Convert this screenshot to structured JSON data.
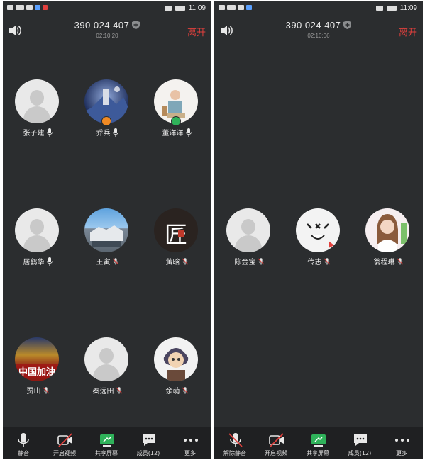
{
  "left": {
    "status": {
      "time": "11:09"
    },
    "header": {
      "meeting_id": "390 024 407",
      "timer": "02:10:20",
      "leave": "离开"
    },
    "participants": [
      {
        "name": "张子建",
        "mic": "on",
        "avatar": "default-avatar"
      },
      {
        "name": "乔兵",
        "mic": "on",
        "avatar": "space-photo",
        "badge": "host"
      },
      {
        "name": "董洋洋",
        "mic": "on",
        "avatar": "child-photo",
        "badge": "cohost"
      },
      {
        "name": "居鹤华",
        "mic": "on",
        "avatar": "default-avatar"
      },
      {
        "name": "王寅",
        "mic": "muted",
        "avatar": "building-photo"
      },
      {
        "name": "黄晗",
        "mic": "muted",
        "avatar": "calligraphy-avatar"
      },
      {
        "name": "贾山",
        "mic": "muted",
        "avatar": "slogan-photo"
      },
      {
        "name": "秦远田",
        "mic": "muted",
        "avatar": "default-avatar"
      },
      {
        "name": "余萌",
        "mic": "muted",
        "avatar": "cartoon-avatar"
      }
    ],
    "slogan_text": "中国加油",
    "calligraphy_char": "匠",
    "toolbar": [
      {
        "label": "静音",
        "icon": "microphone-icon"
      },
      {
        "label": "开启视频",
        "icon": "video-off-icon"
      },
      {
        "label": "共享屏幕",
        "icon": "share-screen-icon"
      },
      {
        "label": "成员(12)",
        "icon": "members-icon"
      },
      {
        "label": "更多",
        "icon": "more-icon"
      }
    ]
  },
  "right": {
    "status": {
      "time": "11:09"
    },
    "header": {
      "meeting_id": "390 024 407",
      "timer": "02:10:06",
      "leave": "离开"
    },
    "participants": [
      {
        "name": "陈金宝",
        "mic": "muted",
        "avatar": "default-avatar"
      },
      {
        "name": "传志",
        "mic": "muted",
        "avatar": "cute-face-avatar"
      },
      {
        "name": "翁程琳",
        "mic": "muted",
        "avatar": "girl-photo"
      }
    ],
    "toolbar": [
      {
        "label": "解除静音",
        "icon": "microphone-muted-icon"
      },
      {
        "label": "开启视频",
        "icon": "video-off-icon"
      },
      {
        "label": "共享屏幕",
        "icon": "share-screen-icon"
      },
      {
        "label": "成员(12)",
        "icon": "members-icon"
      },
      {
        "label": "更多",
        "icon": "more-icon"
      }
    ]
  },
  "colors": {
    "accent_red": "#e2403d",
    "screen_bg": "#2b2d2f",
    "toolbar_bg": "#1f2022",
    "share_green": "#2fb25a",
    "host_badge": "#f08a24",
    "cohost_badge": "#2fb25a"
  }
}
